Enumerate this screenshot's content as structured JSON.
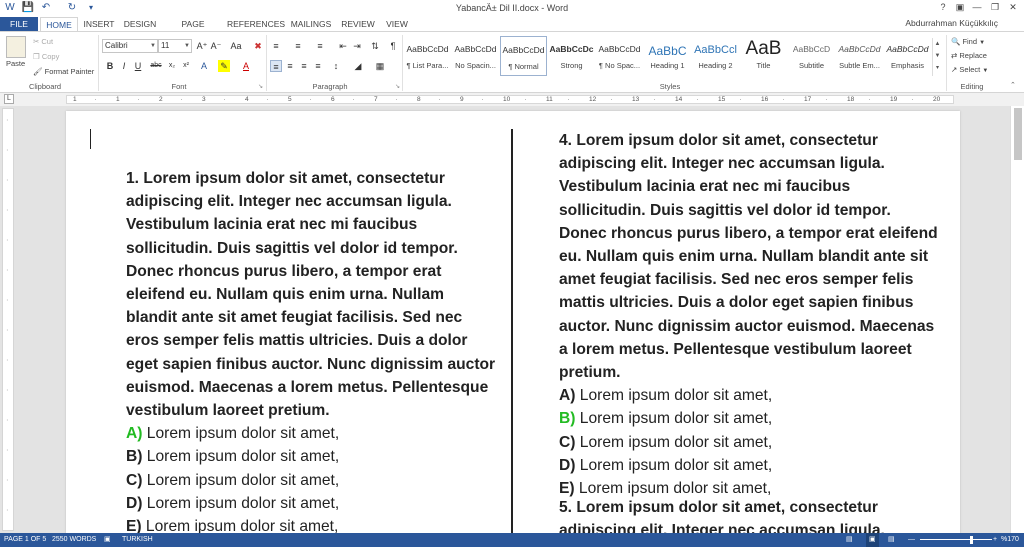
{
  "window": {
    "title": "YabancÄ± Dil II.docx - Word",
    "user": "Abdurrahman Küçükkılıç"
  },
  "tabs": [
    "FILE",
    "HOME",
    "INSERT",
    "DESIGN",
    "PAGE LAYOUT",
    "REFERENCES",
    "MAILINGS",
    "REVIEW",
    "VIEW"
  ],
  "clipboard": {
    "paste": "Paste",
    "cut": "Cut",
    "copy": "Copy",
    "format_painter": "Format Painter",
    "label": "Clipboard"
  },
  "font": {
    "name": "Calibri",
    "size": "11",
    "label": "Font"
  },
  "paragraph": {
    "label": "Paragraph"
  },
  "styles": {
    "label": "Styles",
    "items": [
      {
        "preview": "AaBbCcDd",
        "name": "¶ List Para..."
      },
      {
        "preview": "AaBbCcDd",
        "name": "No Spacin..."
      },
      {
        "preview": "AaBbCcDd",
        "name": "¶ Normal"
      },
      {
        "preview": "AaBbCcDc",
        "name": "Strong"
      },
      {
        "preview": "AaBbCcDd",
        "name": "¶ No Spac..."
      },
      {
        "preview": "AaBbC",
        "name": "Heading 1"
      },
      {
        "preview": "AaBbCcl",
        "name": "Heading 2"
      },
      {
        "preview": "AaB",
        "name": "Title"
      },
      {
        "preview": "AaBbCcD",
        "name": "Subtitle"
      },
      {
        "preview": "AaBbCcDd",
        "name": "Subtle Em..."
      },
      {
        "preview": "AaBbCcDd",
        "name": "Emphasis"
      }
    ]
  },
  "editing": {
    "find": "Find",
    "replace": "Replace",
    "select": "Select",
    "label": "Editing"
  },
  "ruler": {
    "ticks": [
      "1",
      "·",
      "1",
      "·",
      "2",
      "·",
      "3",
      "·",
      "4",
      "·",
      "5",
      "·",
      "6",
      "·",
      "7",
      "·",
      "8",
      "·",
      "9",
      "·",
      "10",
      "·",
      "11",
      "·",
      "12",
      "·",
      "13",
      "·",
      "14",
      "·",
      "15",
      "·",
      "16",
      "·",
      "17",
      "·",
      "18",
      "·",
      "19",
      "·",
      "20"
    ]
  },
  "document": {
    "questions": [
      {
        "number": "1.",
        "stem": "Lorem ipsum dolor sit amet, consectetur adipiscing elit. Integer nec accumsan ligula. Vestibulum lacinia erat nec mi faucibus sollicitudin. Duis sagittis vel dolor id tempor. Donec rhoncus purus libero, a tempor erat eleifend eu. Nullam quis enim urna. Nullam blandit ante sit amet feugiat facilisis. Sed nec eros semper felis mattis ultricies. Duis a dolor eget sapien finibus auctor. Nunc dignissim auctor euismod. Maecenas a lorem metus. Pellentesque vestibulum laoreet pretium.",
        "options": [
          {
            "letter": "A)",
            "text": "Lorem ipsum dolor sit amet,",
            "correct": true
          },
          {
            "letter": "B)",
            "text": "Lorem ipsum dolor sit amet,",
            "correct": false
          },
          {
            "letter": "C)",
            "text": "Lorem ipsum dolor sit amet,",
            "correct": false
          },
          {
            "letter": "D)",
            "text": "Lorem ipsum dolor sit amet,",
            "correct": false
          },
          {
            "letter": "E)",
            "text": "Lorem ipsum dolor sit amet,",
            "correct": false
          }
        ]
      },
      {
        "number": "4.",
        "stem": "Lorem ipsum dolor sit amet, consectetur adipiscing elit. Integer nec accumsan ligula. Vestibulum lacinia erat nec mi faucibus sollicitudin. Duis sagittis vel dolor id tempor. Donec rhoncus purus libero, a tempor erat eleifend eu. Nullam quis enim urna. Nullam blandit ante sit amet feugiat facilisis. Sed nec eros semper felis mattis ultricies. Duis a dolor eget sapien finibus auctor. Nunc dignissim auctor euismod. Maecenas a lorem metus. Pellentesque vestibulum laoreet pretium.",
        "options": [
          {
            "letter": "A)",
            "text": "Lorem ipsum dolor sit amet,",
            "correct": false
          },
          {
            "letter": "B)",
            "text": "Lorem ipsum dolor sit amet,",
            "correct": true
          },
          {
            "letter": "C)",
            "text": "Lorem ipsum dolor sit amet,",
            "correct": false
          },
          {
            "letter": "D)",
            "text": "Lorem ipsum dolor sit amet,",
            "correct": false
          },
          {
            "letter": "E)",
            "text": "Lorem ipsum dolor sit amet,",
            "correct": false
          }
        ]
      },
      {
        "number": "5.",
        "stem": "Lorem ipsum dolor sit amet, consectetur adipiscing elit. Integer nec accumsan ligula. Vestibulum lacinia",
        "options": []
      }
    ]
  },
  "status": {
    "page": "PAGE 1 OF 5",
    "words": "2550 WORDS",
    "language": "TURKISH",
    "zoom": "%170"
  },
  "colors": {
    "accent": "#2b579a",
    "correct": "#22bb22"
  }
}
